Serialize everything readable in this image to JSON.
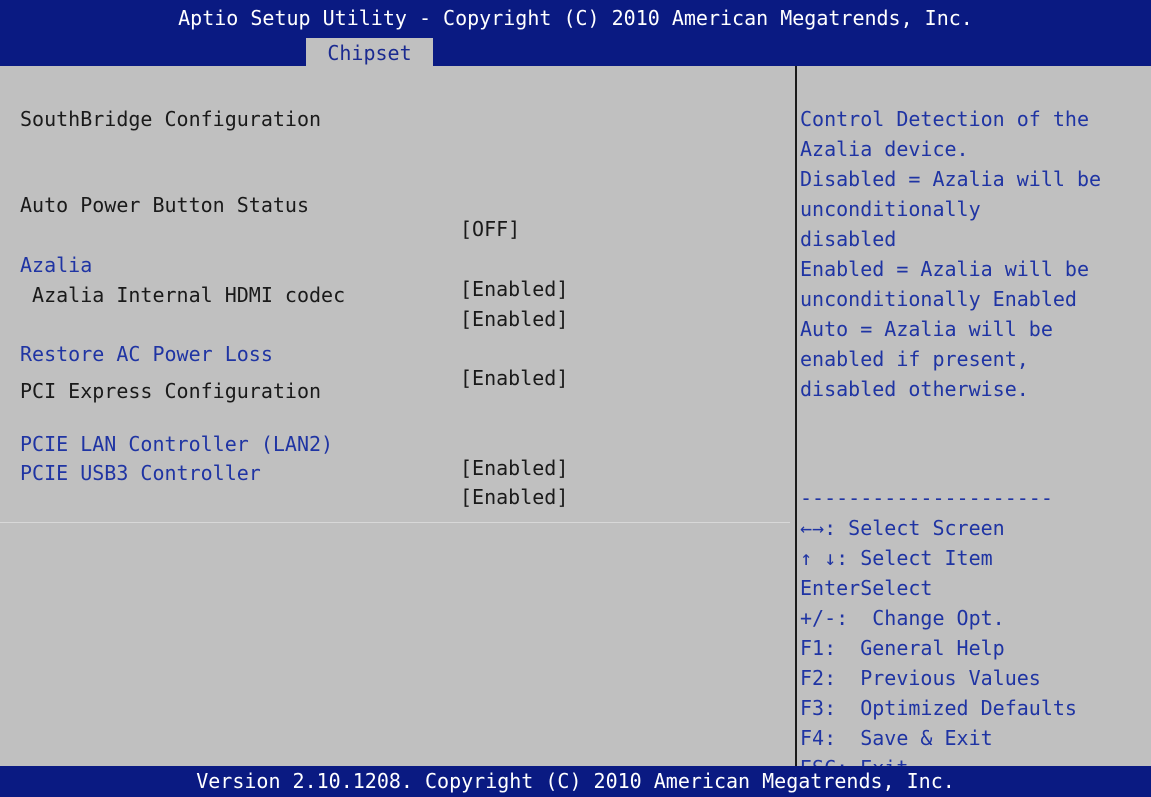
{
  "header": {
    "title": "Aptio Setup Utility - Copyright (C) 2010 American Megatrends, Inc.",
    "active_tab": "Chipset"
  },
  "main": {
    "section_title": "SouthBridge Configuration",
    "items": [
      {
        "label": "Auto Power Button Status",
        "value": "[OFF]"
      },
      {
        "label": "Azalia",
        "value": "[Enabled]"
      },
      {
        "label": " Azalia Internal HDMI codec",
        "value": "[Enabled]"
      },
      {
        "label": "Restore AC Power Loss",
        "value": "[Enabled]"
      }
    ],
    "pci_section_title": "PCI Express Configuration",
    "pci_items": [
      {
        "label": "PCIE LAN Controller (LAN2)",
        "value": "[Enabled]"
      },
      {
        "label": "PCIE USB3 Controller",
        "value": "[Enabled]"
      }
    ]
  },
  "help": {
    "description_lines": [
      "Control Detection of the",
      "Azalia device.",
      "Disabled = Azalia will be",
      "unconditionally",
      "disabled",
      "Enabled = Azalia will be",
      "unconditionally Enabled",
      "Auto = Azalia will be",
      "enabled if present,",
      "disabled otherwise."
    ],
    "separator": "---------------------",
    "keys": [
      "←→: Select Screen",
      "↑ ↓: Select Item",
      "EnterSelect",
      "+/-:  Change Opt.",
      "F1:  General Help",
      "F2:  Previous Values",
      "F3:  Optimized Defaults",
      "F4:  Save & Exit",
      "ESC: Exit"
    ]
  },
  "footer": {
    "version": "Version 2.10.1208. Copyright (C) 2010 American Megatrends, Inc."
  },
  "colors": {
    "header_bg": "#0a1a82",
    "panel_bg": "#c0c0c0",
    "selectable_text": "#1f34a3",
    "static_text": "#1a1a1a"
  }
}
